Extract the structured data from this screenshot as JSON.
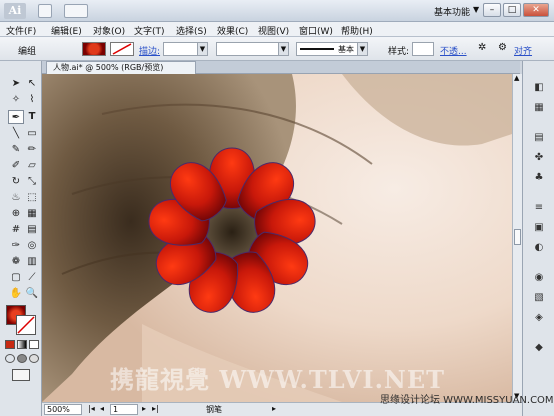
{
  "titlebar": {
    "logo": "Ai",
    "workspace": "基本功能",
    "colors": {
      "accent": "#d81c00"
    }
  },
  "menu": [
    "文件(F)",
    "编辑(E)",
    "对象(O)",
    "文字(T)",
    "选择(S)",
    "效果(C)",
    "视图(V)",
    "窗口(W)",
    "帮助(H)"
  ],
  "control": {
    "group_label": "编组",
    "stroke_label": "描边:",
    "brush_label": "基本",
    "style_label": "样式:",
    "opacity_link": "不透...",
    "align_link": "对齐"
  },
  "document": {
    "tab_title": "人物.ai* @ 500% (RGB/预览)"
  },
  "status": {
    "zoom": "500%",
    "page": "1",
    "tool": "钢笔"
  },
  "watermark": {
    "site": "携龍視覺 WWW.TLVI.NET",
    "forum": "思缘设计论坛 WWW.MISSYUAN.COM"
  }
}
